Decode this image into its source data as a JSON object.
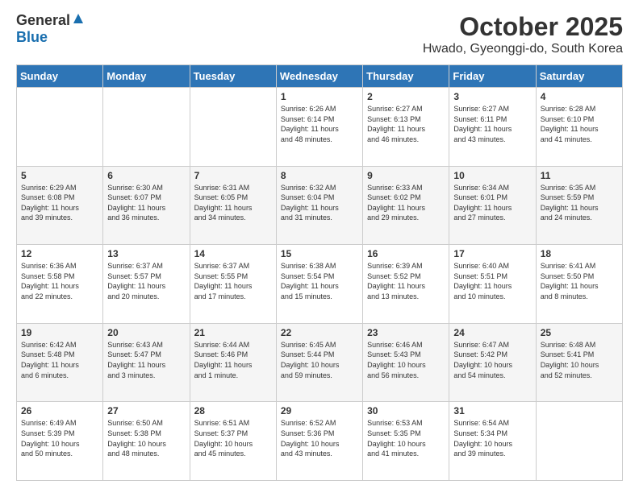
{
  "header": {
    "logo_general": "General",
    "logo_blue": "Blue",
    "month_title": "October 2025",
    "location": "Hwado, Gyeonggi-do, South Korea"
  },
  "weekdays": [
    "Sunday",
    "Monday",
    "Tuesday",
    "Wednesday",
    "Thursday",
    "Friday",
    "Saturday"
  ],
  "weeks": [
    {
      "alt": false,
      "days": [
        {
          "num": "",
          "info": ""
        },
        {
          "num": "",
          "info": ""
        },
        {
          "num": "",
          "info": ""
        },
        {
          "num": "1",
          "info": "Sunrise: 6:26 AM\nSunset: 6:14 PM\nDaylight: 11 hours\nand 48 minutes."
        },
        {
          "num": "2",
          "info": "Sunrise: 6:27 AM\nSunset: 6:13 PM\nDaylight: 11 hours\nand 46 minutes."
        },
        {
          "num": "3",
          "info": "Sunrise: 6:27 AM\nSunset: 6:11 PM\nDaylight: 11 hours\nand 43 minutes."
        },
        {
          "num": "4",
          "info": "Sunrise: 6:28 AM\nSunset: 6:10 PM\nDaylight: 11 hours\nand 41 minutes."
        }
      ]
    },
    {
      "alt": true,
      "days": [
        {
          "num": "5",
          "info": "Sunrise: 6:29 AM\nSunset: 6:08 PM\nDaylight: 11 hours\nand 39 minutes."
        },
        {
          "num": "6",
          "info": "Sunrise: 6:30 AM\nSunset: 6:07 PM\nDaylight: 11 hours\nand 36 minutes."
        },
        {
          "num": "7",
          "info": "Sunrise: 6:31 AM\nSunset: 6:05 PM\nDaylight: 11 hours\nand 34 minutes."
        },
        {
          "num": "8",
          "info": "Sunrise: 6:32 AM\nSunset: 6:04 PM\nDaylight: 11 hours\nand 31 minutes."
        },
        {
          "num": "9",
          "info": "Sunrise: 6:33 AM\nSunset: 6:02 PM\nDaylight: 11 hours\nand 29 minutes."
        },
        {
          "num": "10",
          "info": "Sunrise: 6:34 AM\nSunset: 6:01 PM\nDaylight: 11 hours\nand 27 minutes."
        },
        {
          "num": "11",
          "info": "Sunrise: 6:35 AM\nSunset: 5:59 PM\nDaylight: 11 hours\nand 24 minutes."
        }
      ]
    },
    {
      "alt": false,
      "days": [
        {
          "num": "12",
          "info": "Sunrise: 6:36 AM\nSunset: 5:58 PM\nDaylight: 11 hours\nand 22 minutes."
        },
        {
          "num": "13",
          "info": "Sunrise: 6:37 AM\nSunset: 5:57 PM\nDaylight: 11 hours\nand 20 minutes."
        },
        {
          "num": "14",
          "info": "Sunrise: 6:37 AM\nSunset: 5:55 PM\nDaylight: 11 hours\nand 17 minutes."
        },
        {
          "num": "15",
          "info": "Sunrise: 6:38 AM\nSunset: 5:54 PM\nDaylight: 11 hours\nand 15 minutes."
        },
        {
          "num": "16",
          "info": "Sunrise: 6:39 AM\nSunset: 5:52 PM\nDaylight: 11 hours\nand 13 minutes."
        },
        {
          "num": "17",
          "info": "Sunrise: 6:40 AM\nSunset: 5:51 PM\nDaylight: 11 hours\nand 10 minutes."
        },
        {
          "num": "18",
          "info": "Sunrise: 6:41 AM\nSunset: 5:50 PM\nDaylight: 11 hours\nand 8 minutes."
        }
      ]
    },
    {
      "alt": true,
      "days": [
        {
          "num": "19",
          "info": "Sunrise: 6:42 AM\nSunset: 5:48 PM\nDaylight: 11 hours\nand 6 minutes."
        },
        {
          "num": "20",
          "info": "Sunrise: 6:43 AM\nSunset: 5:47 PM\nDaylight: 11 hours\nand 3 minutes."
        },
        {
          "num": "21",
          "info": "Sunrise: 6:44 AM\nSunset: 5:46 PM\nDaylight: 11 hours\nand 1 minute."
        },
        {
          "num": "22",
          "info": "Sunrise: 6:45 AM\nSunset: 5:44 PM\nDaylight: 10 hours\nand 59 minutes."
        },
        {
          "num": "23",
          "info": "Sunrise: 6:46 AM\nSunset: 5:43 PM\nDaylight: 10 hours\nand 56 minutes."
        },
        {
          "num": "24",
          "info": "Sunrise: 6:47 AM\nSunset: 5:42 PM\nDaylight: 10 hours\nand 54 minutes."
        },
        {
          "num": "25",
          "info": "Sunrise: 6:48 AM\nSunset: 5:41 PM\nDaylight: 10 hours\nand 52 minutes."
        }
      ]
    },
    {
      "alt": false,
      "days": [
        {
          "num": "26",
          "info": "Sunrise: 6:49 AM\nSunset: 5:39 PM\nDaylight: 10 hours\nand 50 minutes."
        },
        {
          "num": "27",
          "info": "Sunrise: 6:50 AM\nSunset: 5:38 PM\nDaylight: 10 hours\nand 48 minutes."
        },
        {
          "num": "28",
          "info": "Sunrise: 6:51 AM\nSunset: 5:37 PM\nDaylight: 10 hours\nand 45 minutes."
        },
        {
          "num": "29",
          "info": "Sunrise: 6:52 AM\nSunset: 5:36 PM\nDaylight: 10 hours\nand 43 minutes."
        },
        {
          "num": "30",
          "info": "Sunrise: 6:53 AM\nSunset: 5:35 PM\nDaylight: 10 hours\nand 41 minutes."
        },
        {
          "num": "31",
          "info": "Sunrise: 6:54 AM\nSunset: 5:34 PM\nDaylight: 10 hours\nand 39 minutes."
        },
        {
          "num": "",
          "info": ""
        }
      ]
    }
  ]
}
